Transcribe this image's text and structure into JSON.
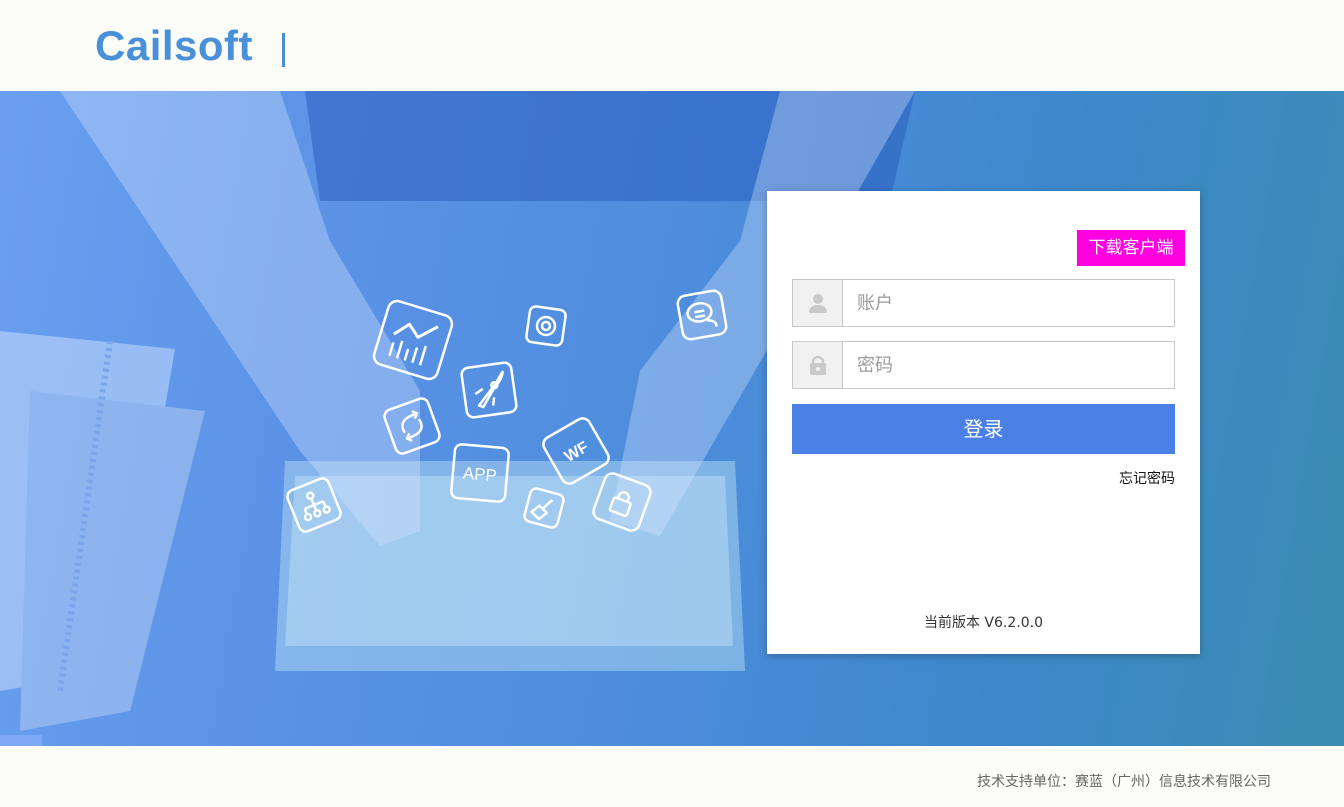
{
  "header": {
    "logo_text": "Cailsoft",
    "logo_separator": "|"
  },
  "hero": {
    "app_icons": [
      "chart-icon",
      "lifebuoy-icon",
      "chat-icon",
      "rocket-icon",
      "refresh-icon",
      "wf-icon",
      "app-icon",
      "flow-icon",
      "broom-icon",
      "lock-icon"
    ],
    "app_icon_labels": {
      "app": "APP",
      "wf": "WF"
    }
  },
  "login": {
    "download_label": "下载客户端",
    "account_placeholder": "账户",
    "password_placeholder": "密码",
    "login_label": "登录",
    "forgot_label": "忘记密码",
    "version_text": "当前版本 V6.2.0.0"
  },
  "footer": {
    "support_text": "技术支持单位：赛蓝（广州）信息技术有限公司"
  },
  "colors": {
    "brand": "#4a90d9",
    "download_button": "#ff00e0",
    "login_button": "#4a80e6",
    "hero_gradient": [
      "#6aa0ee",
      "#3b8cb1"
    ]
  }
}
